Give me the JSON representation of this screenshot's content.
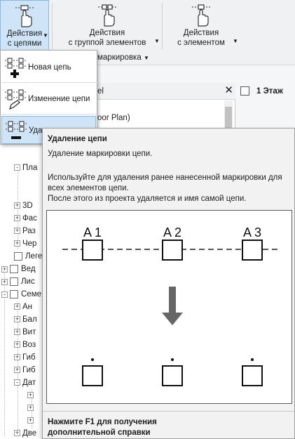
{
  "ribbon": {
    "chains_button": {
      "line1": "Действия",
      "line2": "с цепями"
    },
    "group_button": {
      "line1": "Действия",
      "line2": "с группой элементов"
    },
    "element_button": {
      "line1": "Действия",
      "line2": "с элементом"
    },
    "panel_title": "маркировка"
  },
  "menu": {
    "items": [
      {
        "label": "Новая цепь",
        "icon": "new-chain-icon"
      },
      {
        "label": "Изменение цепи",
        "icon": "edit-chain-icon"
      },
      {
        "label": "Удаление цепи",
        "icon": "delete-chain-icon"
      }
    ]
  },
  "browser": {
    "title_fragment": "el",
    "floor_plan_fragment": "oor Plan)",
    "nodes": [
      {
        "label": "Пла",
        "expander": "-"
      },
      {
        "label": "3D",
        "expander": "+"
      },
      {
        "label": "Фас",
        "expander": "+"
      },
      {
        "label": "Раз",
        "expander": "+"
      },
      {
        "label": "Чер",
        "expander": "+"
      },
      {
        "label": "Леге",
        "expander": "-"
      },
      {
        "label": "Вед",
        "expander": "+"
      },
      {
        "label": "Лис",
        "expander": "+"
      },
      {
        "label": "Семе",
        "expander": "-"
      },
      {
        "label": "Ан",
        "expander": "+"
      },
      {
        "label": "Бал",
        "expander": "+"
      },
      {
        "label": "Вит",
        "expander": "+"
      },
      {
        "label": "Воз",
        "expander": "+"
      },
      {
        "label": "Гиб",
        "expander": "+"
      },
      {
        "label": "Гиб",
        "expander": "+"
      },
      {
        "label": "Дат",
        "expander": "-"
      },
      {
        "label": "Две",
        "expander": "+"
      }
    ]
  },
  "view_tab": {
    "label": "1 Этаж"
  },
  "tooltip": {
    "title": "Удаление цепи",
    "short": "Удаление маркировки цепи.",
    "long": [
      "Используйте для удаления ранее нанесенной маркировки для",
      "всех элементов цепи.",
      "После этого из проекта удаляется и имя самой цепи."
    ],
    "figure_labels": [
      "A 1",
      "A 2",
      "A 3"
    ],
    "footer_line1": "Нажмите F1 для получения",
    "footer_line2": "дополнительной справки"
  },
  "colors": {
    "accent": "#cfe4f7",
    "accent_border": "#86b8e3"
  }
}
